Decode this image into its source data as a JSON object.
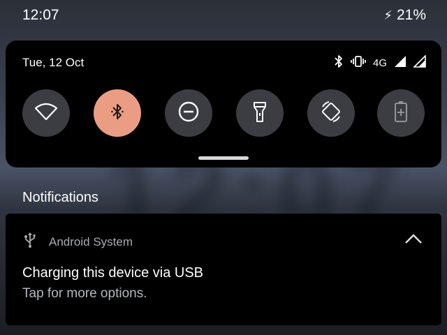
{
  "status_bar": {
    "time": "12:07",
    "battery_percent": "21%",
    "charging_icon": "bolt-icon"
  },
  "quick_settings": {
    "date": "Tue, 12 Oct",
    "network_label": "4G",
    "status_icons": [
      "bluetooth-icon",
      "vibrate-icon",
      "signal-icon",
      "signal-icon"
    ],
    "tiles": [
      {
        "name": "wifi",
        "icon": "wifi-icon",
        "active": false
      },
      {
        "name": "bluetooth",
        "icon": "bluetooth-icon",
        "active": true
      },
      {
        "name": "do-not-disturb",
        "icon": "do-not-disturb-icon",
        "active": false
      },
      {
        "name": "flashlight",
        "icon": "flashlight-icon",
        "active": false
      },
      {
        "name": "auto-rotate",
        "icon": "auto-rotate-icon",
        "active": false
      },
      {
        "name": "battery-saver",
        "icon": "battery-saver-icon",
        "active": false
      }
    ],
    "accent_color": "#eb9d84",
    "tile_color": "#3b3d42"
  },
  "wallpaper": {
    "clock_text": "12:07"
  },
  "notifications": {
    "header": "Notifications",
    "items": [
      {
        "app_name": "Android System",
        "app_icon": "usb-icon",
        "title": "Charging this device via USB",
        "body": "Tap for more options."
      }
    ]
  }
}
